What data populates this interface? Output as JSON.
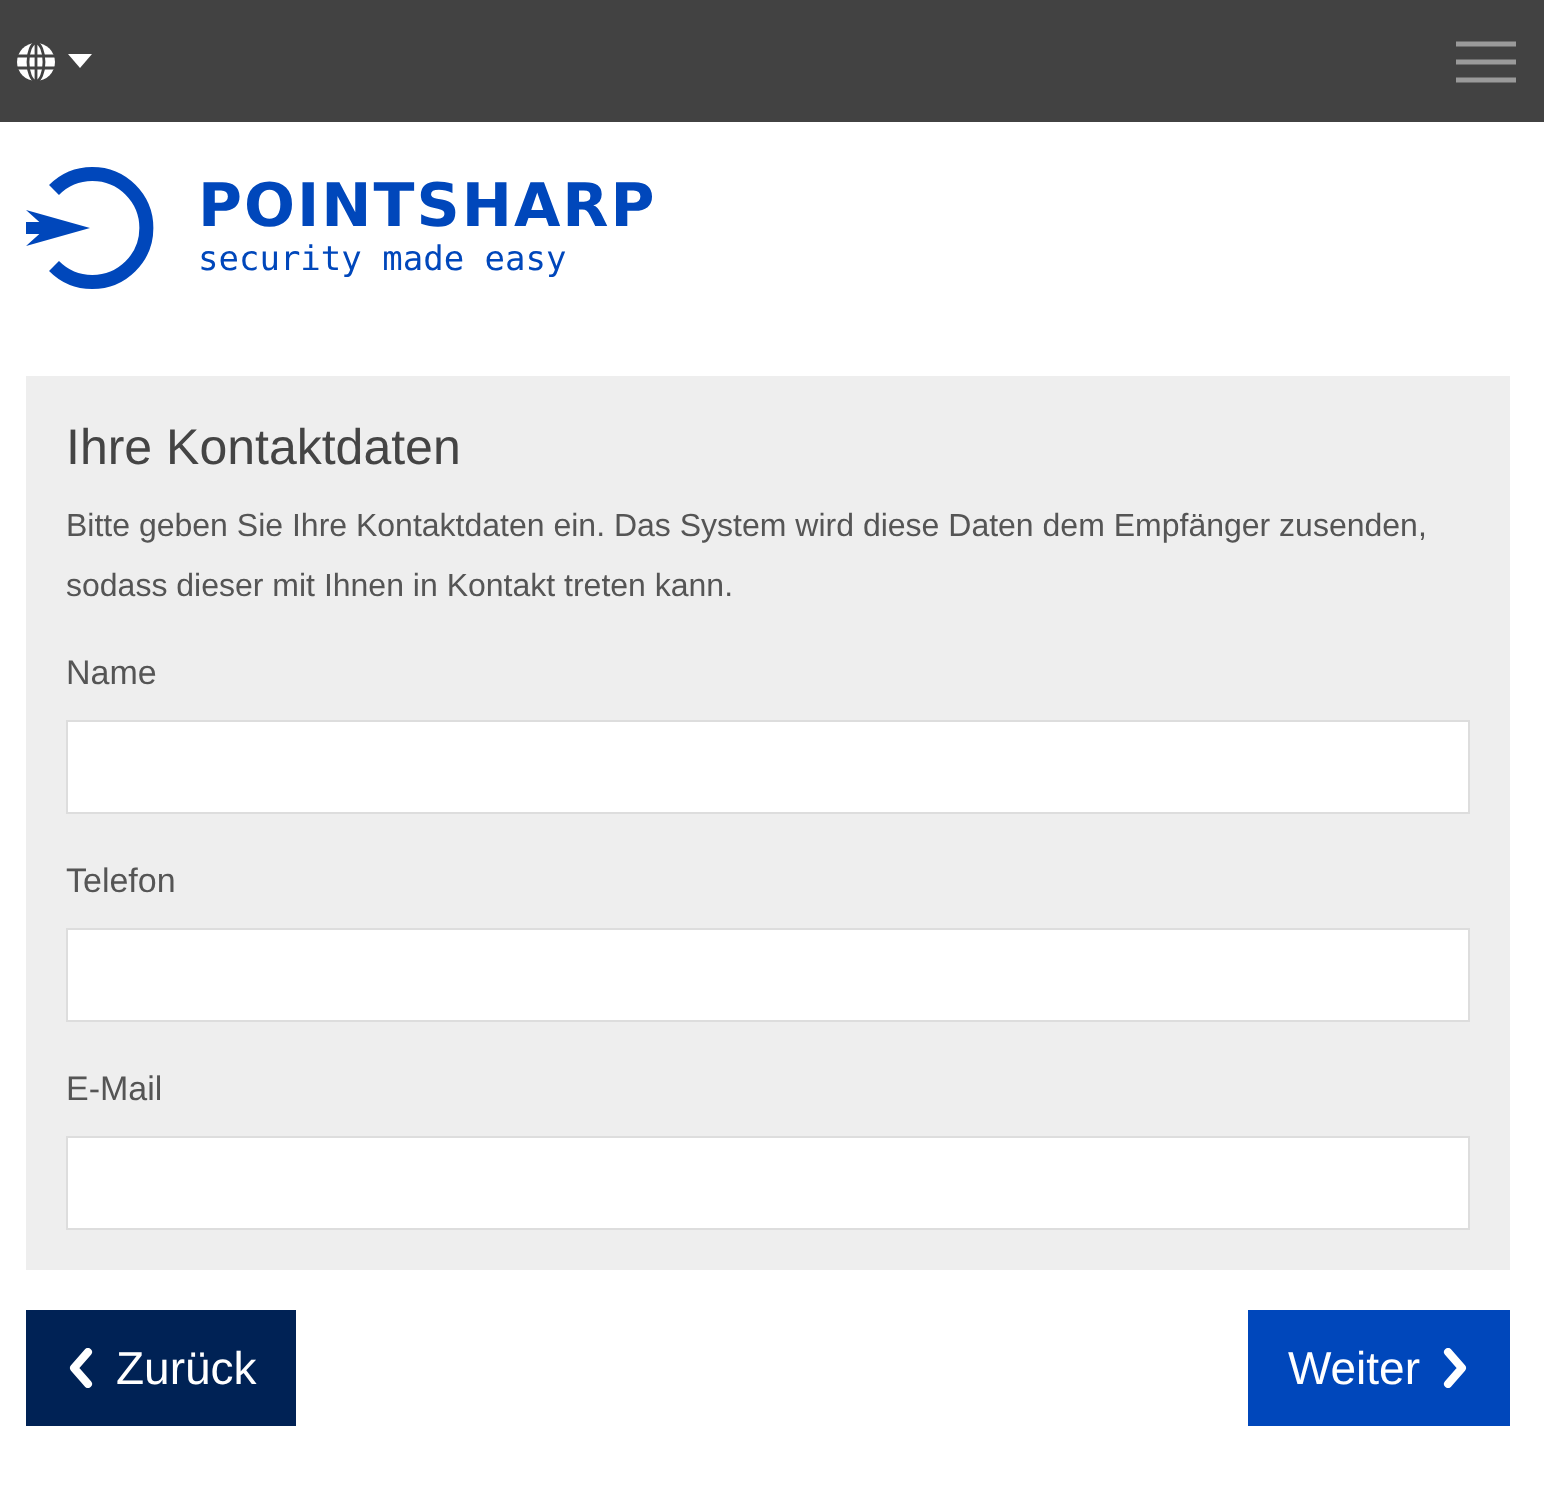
{
  "logo": {
    "name": "POINTSHARP",
    "tagline": "security made easy"
  },
  "form": {
    "title": "Ihre Kontaktdaten",
    "description": "Bitte geben Sie Ihre Kontaktdaten ein. Das System wird diese Daten dem Empfänger zusenden, sodass dieser mit Ihnen in Kontakt treten kann.",
    "fields": [
      {
        "label": "Name"
      },
      {
        "label": "Telefon"
      },
      {
        "label": "E-Mail"
      }
    ]
  },
  "buttons": [
    {
      "label": "Zurück",
      "kind": "back"
    },
    {
      "label": "Weiter",
      "kind": "next"
    }
  ]
}
